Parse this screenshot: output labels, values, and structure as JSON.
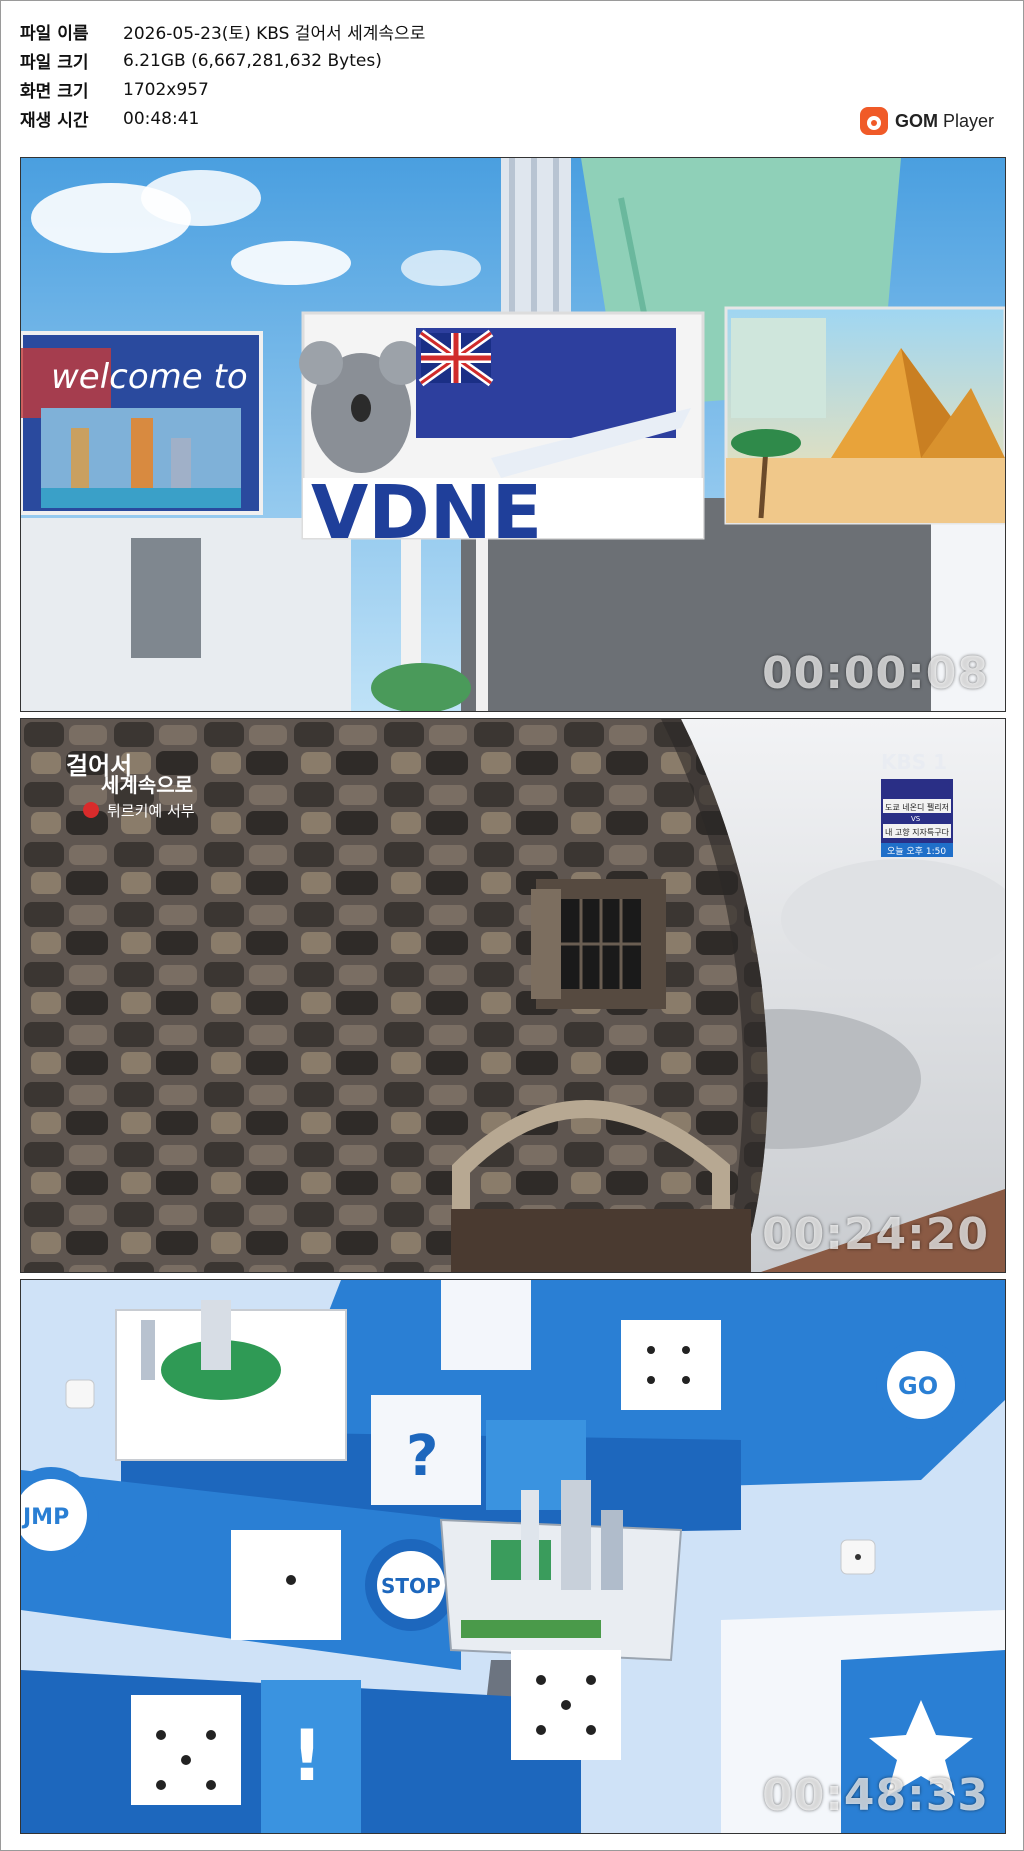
{
  "info": {
    "rows": [
      {
        "label": "파일 이름",
        "value": "2026-05-23(토) KBS 걸어서 세계속으로"
      },
      {
        "label": "파일 크기",
        "value": "6.21GB (6,667,281,632 Bytes)"
      },
      {
        "label": "화면 크기",
        "value": "1702x957"
      },
      {
        "label": "재생 시간",
        "value": "00:48:41"
      }
    ]
  },
  "logo": {
    "gom": "GOM",
    "player": " Player"
  },
  "shots": [
    {
      "timestamp": "00:00:08",
      "sign_text": "welcome to",
      "sign_fragment": "VDNE"
    },
    {
      "timestamp": "00:24:20",
      "program_title_line1": "걸어서",
      "program_title_line2": "세계속으로",
      "episode": "튀르키예 서부",
      "channel": "KBS 1",
      "promo_lines": [
        "도쿄 네온디 펠리저",
        "VS",
        "내 고향 지자특구다"
      ],
      "promo_time": "오늘 오후 1:50"
    },
    {
      "timestamp": "00:48:33",
      "board_labels": {
        "go": "GO",
        "stop": "STOP",
        "jump": "JMP"
      }
    }
  ],
  "colors": {
    "accent": "#f05a28",
    "board_blue": "#1f6fc9"
  }
}
